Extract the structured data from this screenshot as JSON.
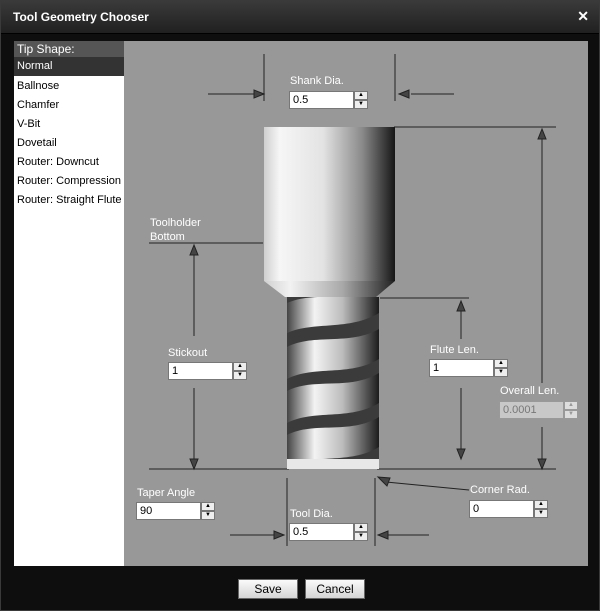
{
  "window": {
    "title": "Tool Geometry Chooser"
  },
  "tip_shape": {
    "header": "Tip Shape:",
    "items": [
      {
        "label": "Normal",
        "selected": true
      },
      {
        "label": "Ballnose"
      },
      {
        "label": "Chamfer"
      },
      {
        "label": "V-Bit"
      },
      {
        "label": "Dovetail"
      },
      {
        "label": "Router: Downcut"
      },
      {
        "label": "Router: Compression"
      },
      {
        "label": "Router: Straight Flute"
      }
    ]
  },
  "fields": {
    "shank_dia": {
      "label": "Shank Dia.",
      "value": "0.5"
    },
    "toolholder_bottom": {
      "line1": "Toolholder",
      "line2": "Bottom"
    },
    "stickout": {
      "label": "Stickout",
      "value": "1"
    },
    "flute_len": {
      "label": "Flute Len.",
      "value": "1"
    },
    "overall_len": {
      "label": "Overall Len.",
      "value": "0.0001",
      "disabled": true
    },
    "taper_angle": {
      "label": "Taper Angle",
      "value": "90"
    },
    "tool_dia": {
      "label": "Tool Dia.",
      "value": "0.5"
    },
    "corner_rad": {
      "label": "Corner Rad.",
      "value": "0"
    }
  },
  "footer": {
    "save_label": "Save",
    "cancel_label": "Cancel"
  },
  "colors": {
    "canvas_bg": "#989898",
    "selected_bg": "#333333",
    "header_bg": "#555555"
  },
  "icons": {
    "close": "close-icon",
    "spin_up": "arrow-up-icon",
    "spin_down": "arrow-down-icon"
  }
}
